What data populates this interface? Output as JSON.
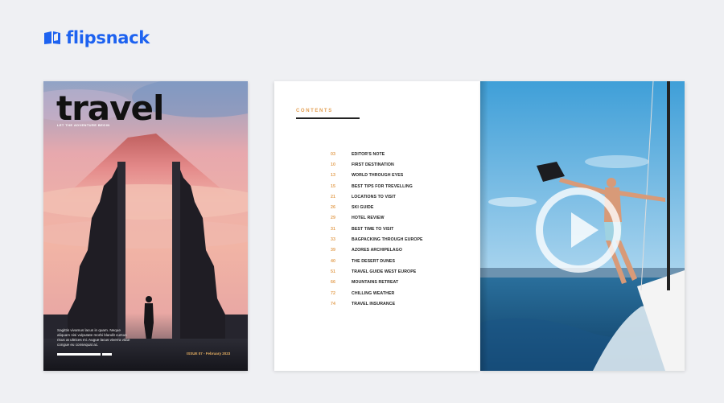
{
  "brand": {
    "name": "flipsnack",
    "color": "#1d62f0"
  },
  "cover": {
    "title": "travel",
    "tagline": "LET THE ADVENTURE BEGIN",
    "blurb": "Sagittis vivamus lacus in quam. Neque aliquam nisi vulputate morbi blandit cursus risus at ultrices mi. Augue lacus viverra vitae congue eu consequat ac.",
    "issue": "ISSUE 07 - February 2023",
    "accent": "#e7b062"
  },
  "contents": {
    "heading": "CONTENTS",
    "accent": "#e3a054",
    "items": [
      {
        "page": "03",
        "title": "EDITOR'S NOTE"
      },
      {
        "page": "10",
        "title": "FIRST DESTINATION"
      },
      {
        "page": "13",
        "title": "WORLD THROUGH EYES"
      },
      {
        "page": "15",
        "title": "BEST TIPS FOR TREVELLING"
      },
      {
        "page": "21",
        "title": "LOCATIONS TO VISIT"
      },
      {
        "page": "26",
        "title": "SKI GUIDE"
      },
      {
        "page": "29",
        "title": "HOTEL REVIEW"
      },
      {
        "page": "31",
        "title": "BEST TIME TO VISIT"
      },
      {
        "page": "33",
        "title": "BAGPACKING THROUGH EUROPE"
      },
      {
        "page": "39",
        "title": "AZORES ARCHIPELAGO"
      },
      {
        "page": "40",
        "title": "THE DESERT DUNES"
      },
      {
        "page": "51",
        "title": "TRAVEL GUIDE WEST EUROPE"
      },
      {
        "page": "66",
        "title": "MOUNTAINS RETREAT"
      },
      {
        "page": "72",
        "title": "CHILLING WEATHER"
      },
      {
        "page": "74",
        "title": "TRAVEL INSURANCE"
      }
    ]
  },
  "video": {
    "control": "play-icon"
  }
}
